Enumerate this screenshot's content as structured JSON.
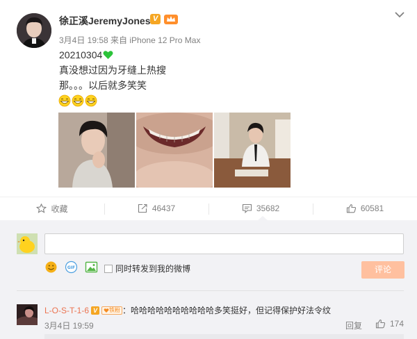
{
  "post": {
    "author": "徐正溪JeremyJones",
    "verified_badge": "V",
    "meta": "3月4日 19:58 来自 iPhone 12 Pro Max",
    "lines": [
      "20210304",
      "真没想过因为牙缝上热搜",
      "那。。。以后就多笑笑"
    ],
    "emoji_count": 3,
    "photo_count": 3
  },
  "actions": {
    "favorite_label": "收藏",
    "repost_count": "46437",
    "comment_count": "35682",
    "like_count": "60581"
  },
  "composer": {
    "input_value": "",
    "input_placeholder": "",
    "forward_label": "同时转发到我的微博",
    "submit_label": "评论"
  },
  "comment": {
    "author": "L-O-S-T-1-6",
    "verified_badge": "V",
    "fan_badge": "铁粉",
    "text": "：哈哈哈哈哈哈哈哈哈哈多笑挺好，但记得保护好法令纹",
    "time": "3月4日 19:59",
    "reply_label": "回复",
    "like_count": "174"
  },
  "colors": {
    "accent_orange": "#eb7350",
    "submit_disabled": "#ffc09f",
    "heart_green": "#2cc33a",
    "verified_gold": "#f5a623"
  }
}
